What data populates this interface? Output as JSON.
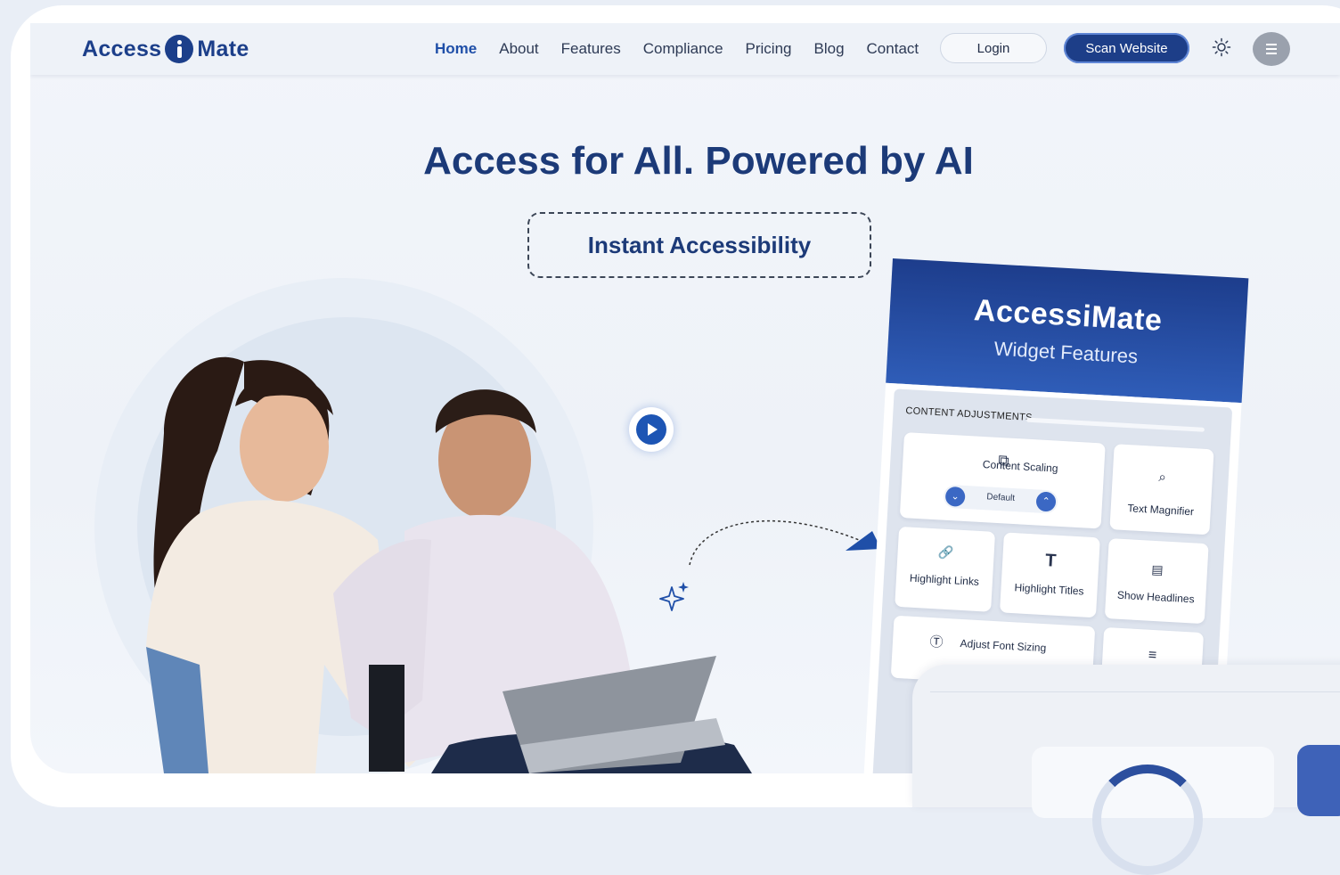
{
  "header": {
    "logo_left": "Access",
    "logo_right": "Mate",
    "nav": [
      "Home",
      "About",
      "Features",
      "Compliance",
      "Pricing",
      "Blog",
      "Contact"
    ],
    "active": "Home",
    "login": "Login",
    "scan": "Scan Website"
  },
  "hero": {
    "title": "Access for All. Powered by AI",
    "badge": "Instant Accessibility"
  },
  "widget": {
    "title": "AccessiMate",
    "subtitle": "Widget Features",
    "section": "CONTENT ADJUSTMENTS",
    "content_scaling": "Content Scaling",
    "scaling_value": "Default",
    "text_magnifier": "Text Magnifier",
    "highlight_links": "Highlight Links",
    "highlight_titles": "Highlight Titles",
    "show_headlines": "Show Headlines",
    "adjust_font_sizing": "Adjust Font Sizing",
    "icons": {
      "content_scaling": "scaling-icon",
      "text_magnifier": "magnifier-icon",
      "highlight_links": "link-icon",
      "highlight_titles": "T",
      "show_headlines": "headlines-icon",
      "adjust_font_sizing": "font-size-icon",
      "align": "align-center-icon"
    }
  },
  "colors": {
    "brand": "#1c3f8a",
    "accent": "#1f4fa8",
    "scan_button": "#1d3e88",
    "widget_header": "#2f5db8"
  }
}
